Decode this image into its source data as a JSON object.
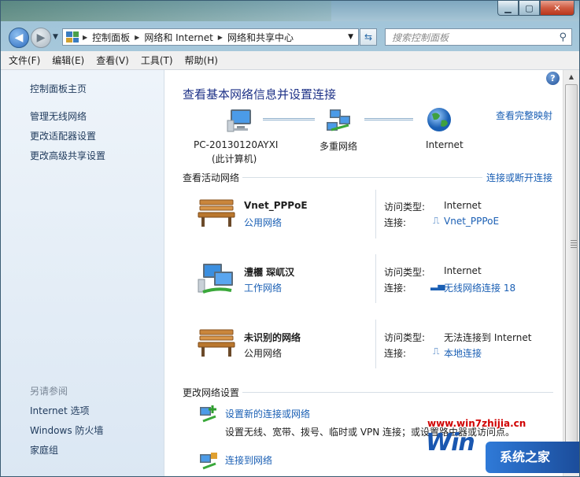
{
  "window": {
    "caption_buttons": {
      "minimize": "▁",
      "maximize": "▢",
      "close": "✕"
    }
  },
  "address": {
    "segments": [
      "控制面板",
      "网络和 Internet",
      "网络和共享中心"
    ],
    "search_placeholder": "搜索控制面板"
  },
  "menu": [
    "文件(F)",
    "编辑(E)",
    "查看(V)",
    "工具(T)",
    "帮助(H)"
  ],
  "sidebar": {
    "links": [
      "控制面板主页",
      "管理无线网络",
      "更改适配器设置",
      "更改高级共享设置"
    ],
    "see_also_title": "另请参阅",
    "see_also": [
      "Internet 选项",
      "Windows 防火墙",
      "家庭组"
    ]
  },
  "main": {
    "title": "查看基本网络信息并设置连接",
    "view_full_map": "查看完整映射",
    "map": {
      "computer_name": "PC-20130120AYXI",
      "computer_sub": "(此计算机)",
      "middle": "多重网络",
      "internet": "Internet"
    },
    "active_header": "查看活动网络",
    "connect_disconnect": "连接或断开连接",
    "networks": [
      {
        "name": "Vnet_PPPoE",
        "type": "公用网络",
        "type_is_link": true,
        "access_label": "访问类型:",
        "access": "Internet",
        "conn_label": "连接:",
        "conn": "Vnet_PPPoE"
      },
      {
        "name": "澧欐   琛屼汉",
        "type": "工作网络",
        "type_is_link": true,
        "access_label": "访问类型:",
        "access": "Internet",
        "conn_label": "连接:",
        "conn": "无线网络连接 18"
      },
      {
        "name": "未识别的网络",
        "type": "公用网络",
        "type_is_link": false,
        "access_label": "访问类型:",
        "access": "无法连接到 Internet",
        "conn_label": "连接:",
        "conn": "本地连接"
      }
    ],
    "change_header": "更改网络设置",
    "tasks": [
      {
        "label": "设置新的连接或网络",
        "desc": "设置无线、宽带、拨号、临时或 VPN 连接；或设置路由器或访问点。"
      },
      {
        "label": "连接到网络"
      }
    ]
  },
  "watermark": {
    "url": "www.win7zhijia.cn",
    "logo": "Win",
    "site": "系统之家"
  },
  "colors": {
    "link": "#1a5fb4",
    "title": "#1e3287",
    "sidebar_link": "#1e395b"
  }
}
